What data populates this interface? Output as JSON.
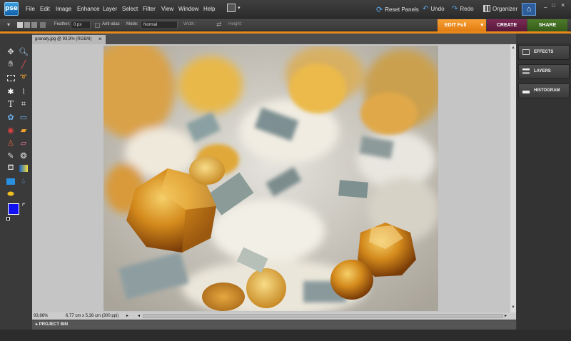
{
  "app": {
    "logo": "pse",
    "window_controls": [
      "_",
      "□",
      "×"
    ]
  },
  "menu": [
    "File",
    "Edit",
    "Image",
    "Enhance",
    "Layer",
    "Select",
    "Filter",
    "View",
    "Window",
    "Help"
  ],
  "toolbar": {
    "reset_panels": "Reset Panels",
    "undo": "Undo",
    "redo": "Redo",
    "organizer": "Organizer"
  },
  "options": {
    "feather_label": "Feather:",
    "feather_value": "0 px",
    "antialias_label": "Anti-alias",
    "mode_label": "Mode:",
    "mode_value": "Normal",
    "width_label": "Width:",
    "height_label": "Height:"
  },
  "tabs": {
    "edit": "EDIT Full",
    "create": "CREATE",
    "share": "SHARE"
  },
  "document": {
    "tab_title": "granaty.jpg @ 93,9% (RGB/8)",
    "close": "×"
  },
  "status": {
    "zoom": "93,86%",
    "doc_info": "6,77 cm x 5,38 cm (300 ppi)"
  },
  "project_bin": "PROJECT BIN",
  "panels": [
    "EFFECTS",
    "LAYERS",
    "HISTOGRAM"
  ],
  "colors": {
    "foreground": "#1010f0",
    "background": "#ffffff",
    "accent": "#e68a1e"
  },
  "tools": [
    "move-tool",
    "zoom-tool",
    "hand-tool",
    "eyedropper-tool",
    "marquee-tool",
    "lasso-tool",
    "magic-wand-tool",
    "quick-selection-tool",
    "type-tool",
    "crop-tool",
    "cookie-cutter-tool",
    "straighten-tool",
    "red-eye-tool",
    "spot-healing-tool",
    "clone-stamp-tool",
    "eraser-tool",
    "brush-tool",
    "smart-brush-tool",
    "paint-bucket-tool",
    "gradient-tool",
    "shape-tool",
    "blur-tool",
    "sponge-tool"
  ]
}
